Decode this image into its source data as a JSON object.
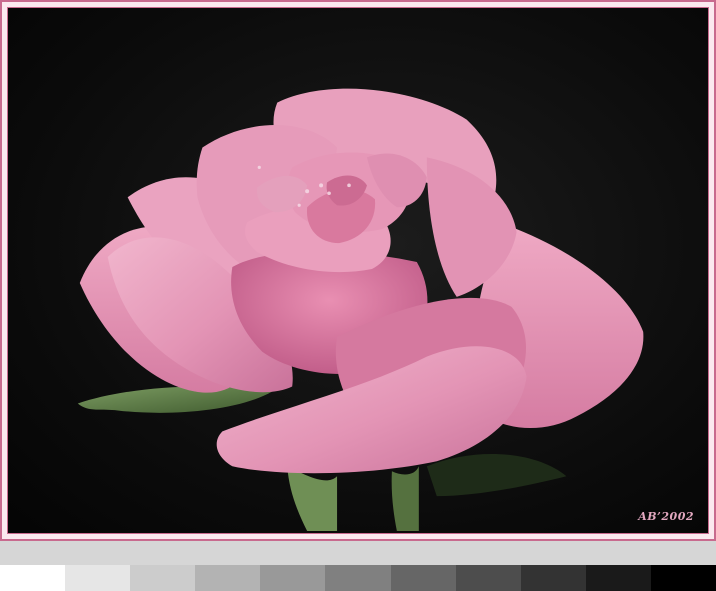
{
  "signature": "AB’2002",
  "swatch_colors": [
    "#ffffff",
    "#e6e6e6",
    "#cccccc",
    "#b3b3b3",
    "#999999",
    "#808080",
    "#666666",
    "#4d4d4d",
    "#333333",
    "#1a1a1a",
    "#000000"
  ],
  "colors": {
    "frame_border": "#c86a8e",
    "frame_fill": "#fbe9ef",
    "background": "#0b0b0b",
    "petal": "#e48fb2",
    "leaf": "#5e7f47"
  }
}
